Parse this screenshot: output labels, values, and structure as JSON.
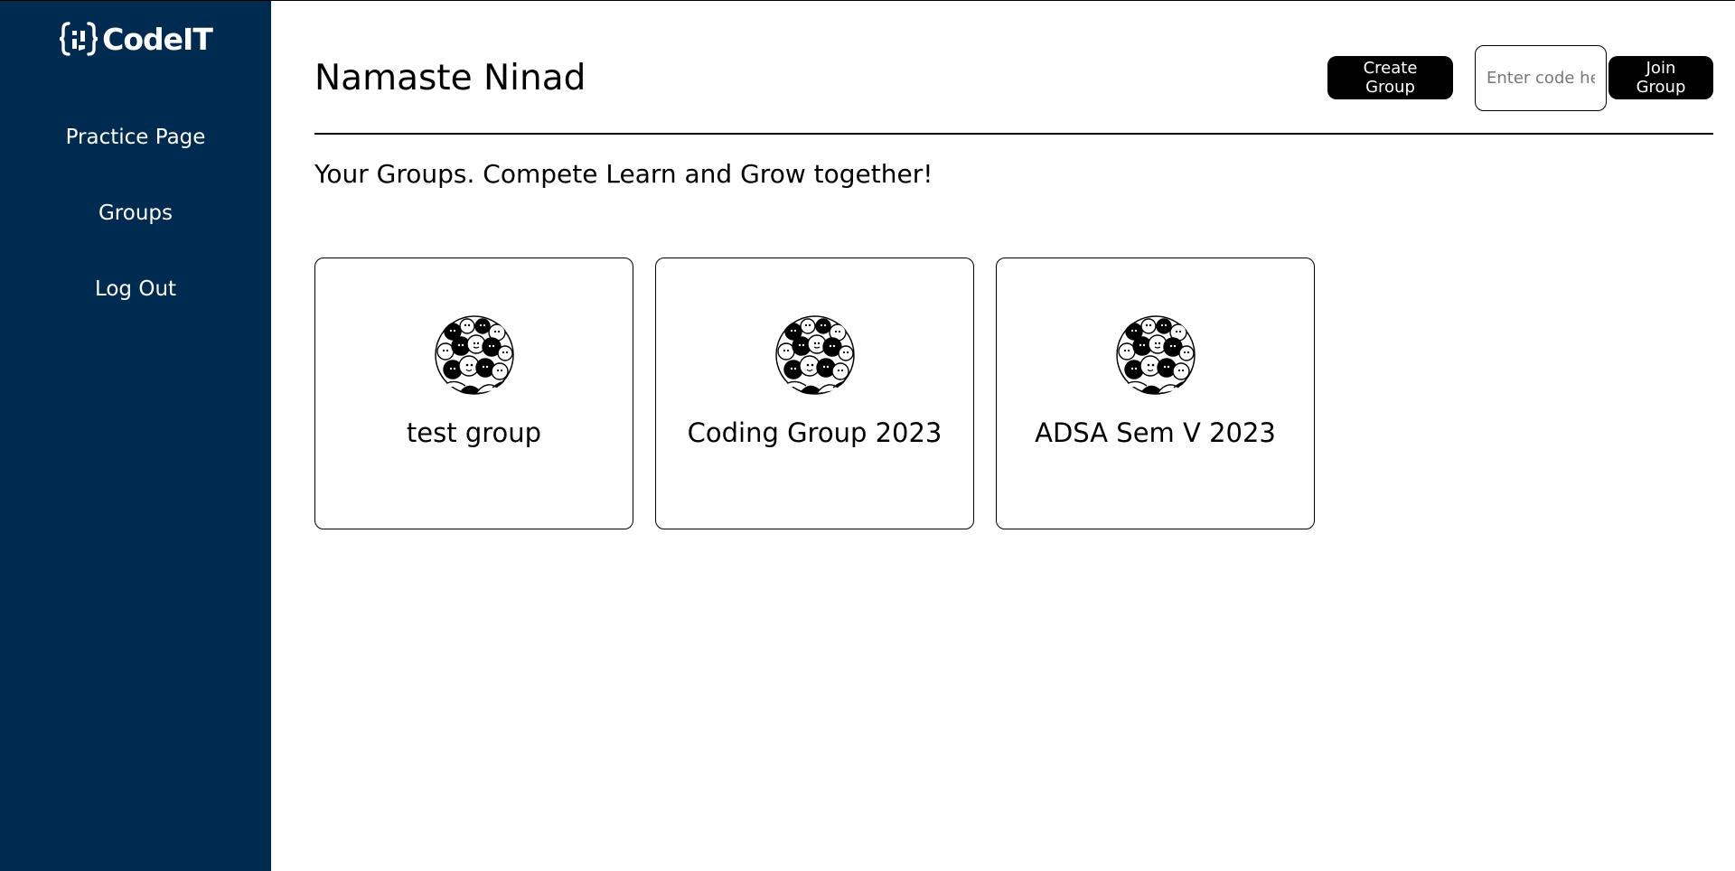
{
  "app": {
    "logo_text": "CodeIT",
    "logo_icon": "braces-logo-icon",
    "colors": {
      "sidebar_bg": "#002b50",
      "sidebar_text": "#ffffff",
      "button_bg": "#000000",
      "button_text": "#ffffff"
    }
  },
  "sidebar": {
    "items": [
      {
        "label": "Practice Page"
      },
      {
        "label": "Groups"
      },
      {
        "label": "Log Out"
      }
    ]
  },
  "header": {
    "greeting": "Namaste Ninad",
    "create_group_label": "Create Group",
    "code_input_placeholder": "Enter code here",
    "code_input_value": "",
    "join_group_label": "Join Group"
  },
  "main": {
    "subtitle": "Your Groups. Compete Learn and Grow together!",
    "groups": [
      {
        "name": "test group",
        "icon": "crowd-avatar-icon"
      },
      {
        "name": "Coding Group 2023",
        "icon": "crowd-avatar-icon"
      },
      {
        "name": "ADSA Sem V 2023",
        "icon": "crowd-avatar-icon"
      }
    ]
  }
}
